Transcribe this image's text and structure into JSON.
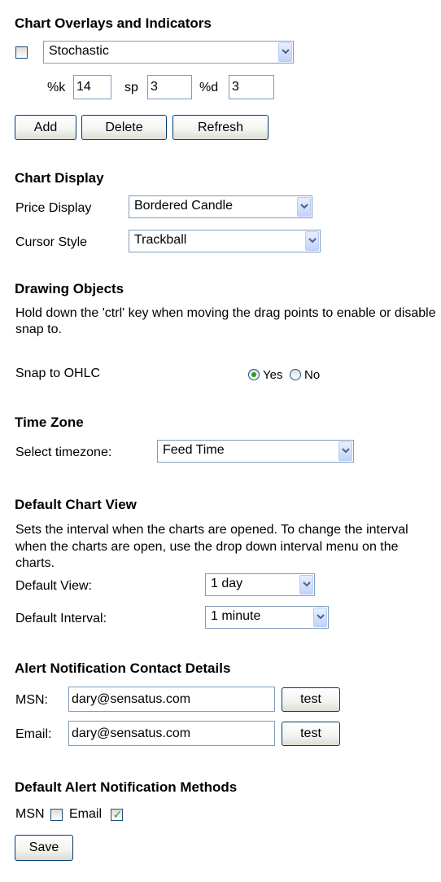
{
  "overlays": {
    "heading": "Chart Overlays and Indicators",
    "indicator_select": "Stochastic",
    "k_label": "%k",
    "k_value": "14",
    "sp_label": "sp",
    "sp_value": "3",
    "d_label": "%d",
    "d_value": "3",
    "add_label": "Add",
    "delete_label": "Delete",
    "refresh_label": "Refresh"
  },
  "display": {
    "heading": "Chart Display",
    "price_label": "Price Display",
    "price_value": "Bordered Candle",
    "cursor_label": "Cursor Style",
    "cursor_value": "Trackball"
  },
  "drawing": {
    "heading": "Drawing Objects",
    "description": "Hold down the 'ctrl' key when moving the drag points to enable or disable snap to.",
    "snap_label": "Snap to OHLC",
    "yes_label": "Yes",
    "no_label": "No",
    "snap_selected": "Yes"
  },
  "timezone": {
    "heading": "Time Zone",
    "select_label": "Select timezone:",
    "select_value": "Feed Time"
  },
  "default_view": {
    "heading": "Default Chart View",
    "description": "Sets the interval when the charts are opened. To change the interval when the charts are open, use the drop down interval menu on the charts.",
    "view_label": "Default View:",
    "view_value": "1 day",
    "interval_label": "Default Interval:",
    "interval_value": "1 minute"
  },
  "contact": {
    "heading": "Alert Notification Contact Details",
    "msn_label": "MSN:",
    "msn_value": "dary@sensatus.com",
    "email_label": "Email:",
    "email_value": "dary@sensatus.com",
    "test_label": "test"
  },
  "methods": {
    "heading": "Default Alert Notification Methods",
    "msn_label": "MSN",
    "msn_checked": false,
    "email_label": "Email",
    "email_checked": true,
    "save_label": "Save"
  },
  "colors": {
    "control_border": "#7f9db9",
    "check_green": "#21a121",
    "button_border": "#003c74"
  }
}
